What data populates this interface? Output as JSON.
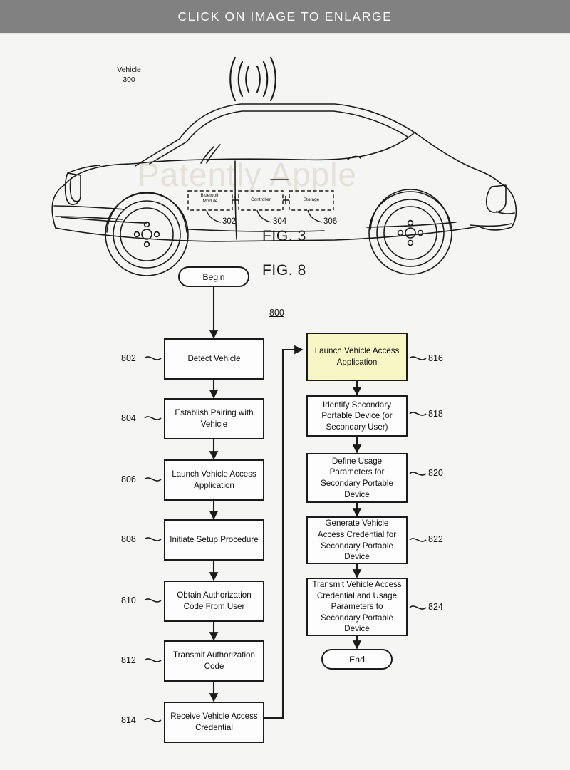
{
  "banner": {
    "text": "CLICK ON IMAGE TO ENLARGE"
  },
  "watermark": {
    "text": "Patently Apple"
  },
  "figures": {
    "fig3_label": "FIG. 3",
    "fig8_label": "FIG. 8"
  },
  "vehicle": {
    "label": "Vehicle",
    "ref": "300",
    "modules": [
      {
        "name": "Bluetooth\nModule",
        "ref": "302"
      },
      {
        "name": "Controller",
        "ref": "304"
      },
      {
        "name": "Storage",
        "ref": "306"
      }
    ],
    "signal_icon": "wireless-waves-icon"
  },
  "flowchart": {
    "ref": "800",
    "begin_label": "Begin",
    "end_label": "End",
    "left_column": [
      {
        "ref": "802",
        "text": "Detect Vehicle"
      },
      {
        "ref": "804",
        "text": "Establish Pairing with Vehicle"
      },
      {
        "ref": "806",
        "text": "Launch Vehicle Access Application"
      },
      {
        "ref": "808",
        "text": "Initiate Setup Procedure"
      },
      {
        "ref": "810",
        "text": "Obtain Authorization Code From User"
      },
      {
        "ref": "812",
        "text": "Transmit Authorization Code"
      },
      {
        "ref": "814",
        "text": "Receive Vehicle Access Credential"
      }
    ],
    "right_column": [
      {
        "ref": "816",
        "text": "Launch Vehicle Access Application",
        "highlighted": true
      },
      {
        "ref": "818",
        "text": "Identify Secondary Portable Device (or Secondary User)",
        "highlighted": false
      },
      {
        "ref": "820",
        "text": "Define Usage Parameters for Secondary Portable Device",
        "highlighted": false
      },
      {
        "ref": "822",
        "text": "Generate Vehicle Access Credential for Secondary Portable Device",
        "highlighted": false
      },
      {
        "ref": "824",
        "text": "Transmit Vehicle Access Credential and Usage Parameters to Secondary Portable Device",
        "highlighted": false
      }
    ]
  },
  "colors": {
    "banner_bg": "#818181",
    "page_bg": "#f5f5f4",
    "highlight": "#f9f6c6",
    "line": "#1b1b1b"
  }
}
